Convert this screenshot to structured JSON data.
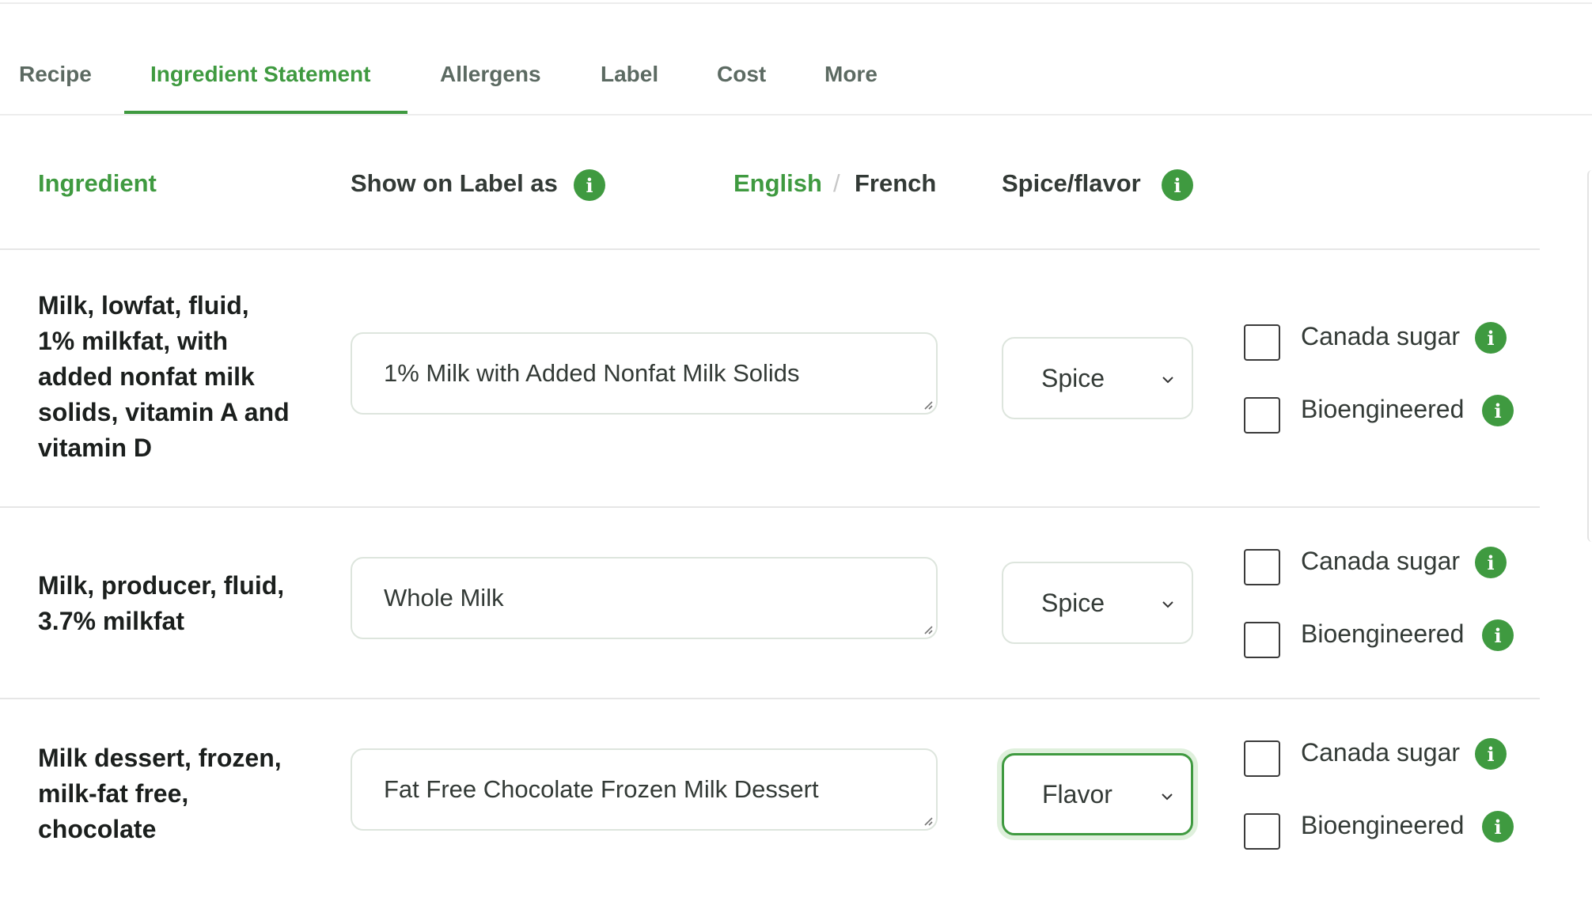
{
  "tabs": [
    {
      "label": "Recipe"
    },
    {
      "label": "Ingredient Statement"
    },
    {
      "label": "Allergens"
    },
    {
      "label": "Label"
    },
    {
      "label": "Cost"
    },
    {
      "label": "More"
    }
  ],
  "active_tab": "Ingredient Statement",
  "header": {
    "ingredient": "Ingredient",
    "show_on_label_as": "Show on Label as",
    "lang_english": "English",
    "lang_separator": "/",
    "lang_french": "French",
    "spice_flavor": "Spice/flavor",
    "info_glyph": "i"
  },
  "rows": [
    {
      "ingredient": "Milk, lowfat, fluid, 1% milkfat, with added nonfat milk solids, vitamin A and vitamin D",
      "label_as": "1% Milk with Added Nonfat Milk Solids",
      "spice_flavor": "Spice",
      "canada_sugar_label": "Canada sugar",
      "canada_sugar_checked": false,
      "bioengineered_label": "Bioengineered",
      "bioengineered_checked": false
    },
    {
      "ingredient": "Milk, producer, fluid, 3.7% milkfat",
      "label_as": "Whole Milk",
      "spice_flavor": "Spice",
      "canada_sugar_label": "Canada sugar",
      "canada_sugar_checked": false,
      "bioengineered_label": "Bioengineered",
      "bioengineered_checked": false
    },
    {
      "ingredient": "Milk dessert, frozen, milk-fat free, chocolate",
      "label_as": "Fat Free Chocolate Frozen Milk Dessert",
      "spice_flavor": "Flavor",
      "canada_sugar_label": "Canada sugar",
      "canada_sugar_checked": false,
      "bioengineered_label": "Bioengineered",
      "bioengineered_checked": false
    }
  ],
  "colors": {
    "accent": "#3f9a40",
    "tab_text": "#5c6a62",
    "border": "#dde5dd"
  },
  "icons": {
    "info": "info-icon",
    "select": "chevron-down-icon",
    "resize": "resize-handle-icon"
  }
}
